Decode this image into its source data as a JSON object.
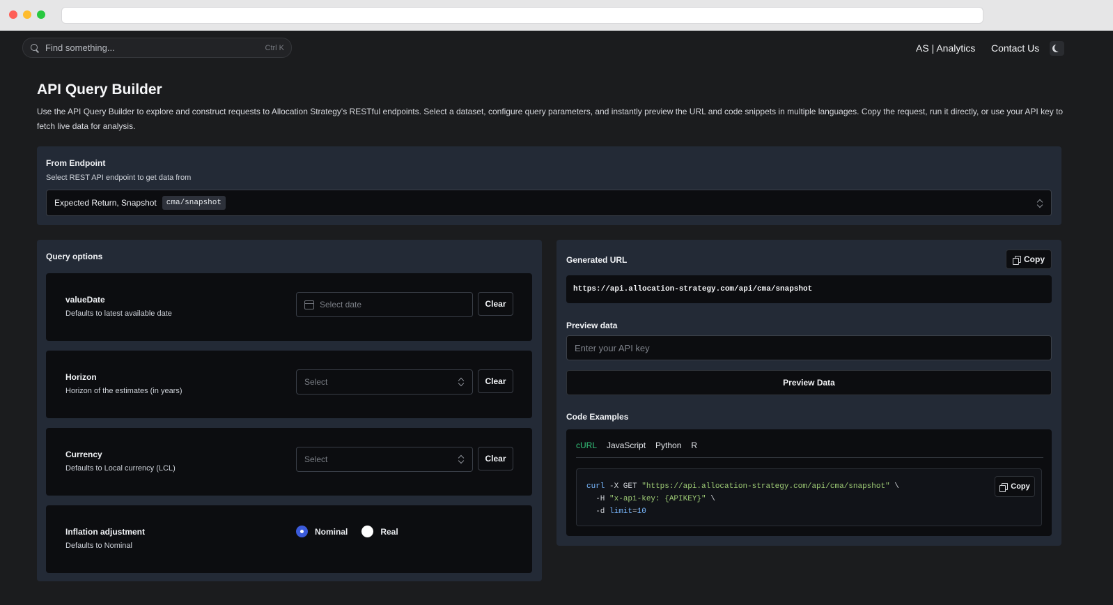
{
  "browser": {
    "url": ""
  },
  "header": {
    "search_placeholder": "Find something...",
    "search_shortcut": "Ctrl K",
    "nav": [
      "AS | Analytics",
      "Contact Us"
    ]
  },
  "page": {
    "title": "API Query Builder",
    "description": "Use the API Query Builder to explore and construct requests to Allocation Strategy's RESTful endpoints. Select a dataset, configure query parameters, and instantly preview the URL and code snippets in multiple languages. Copy the request, run it directly, or use your API key to fetch live data for analysis."
  },
  "endpoint": {
    "label": "From Endpoint",
    "sublabel": "Select REST API endpoint to get data from",
    "selected_name": "Expected Return, Snapshot",
    "selected_path": "cma/snapshot"
  },
  "query_options": {
    "label": "Query options",
    "clear_label": "Clear",
    "items": [
      {
        "title": "valueDate",
        "desc": "Defaults to latest available date",
        "placeholder": "Select date"
      },
      {
        "title": "Horizon",
        "desc": "Horizon of the estimates (in years)",
        "placeholder": "Select"
      },
      {
        "title": "Currency",
        "desc": "Defaults to Local currency (LCL)",
        "placeholder": "Select"
      },
      {
        "title": "Inflation adjustment",
        "desc": "Defaults to Nominal",
        "options": [
          "Nominal",
          "Real"
        ],
        "selected": "Nominal"
      }
    ]
  },
  "generated": {
    "label": "Generated URL",
    "copy_label": "Copy",
    "url": "https://api.allocation-strategy.com/api/cma/snapshot"
  },
  "preview": {
    "label": "Preview data",
    "api_key_placeholder": "Enter your API key",
    "button_label": "Preview Data"
  },
  "code_examples": {
    "label": "Code Examples",
    "tabs": [
      "cURL",
      "JavaScript",
      "Python",
      "R"
    ],
    "active_tab": "cURL",
    "copy_label": "Copy",
    "lines": {
      "l1_cmd": "curl",
      "l1_rest": " -X GET ",
      "l1_str": "\"https://api.allocation-strategy.com/api/cma/snapshot\"",
      "l1_end": " \\",
      "l2_pre": "  -H ",
      "l2_str": "\"x-api-key: {APIKEY}\"",
      "l2_end": " \\",
      "l3_pre": "  -d ",
      "l3_key": "limit",
      "l3_eq": "=",
      "l3_val": "10"
    }
  },
  "colors": {
    "app_bg": "#1b1c1e",
    "panel_bg": "#232a36",
    "card_bg": "#0c0d10",
    "active_tab": "#34c27a",
    "radio_on": "#3b5bdb"
  }
}
